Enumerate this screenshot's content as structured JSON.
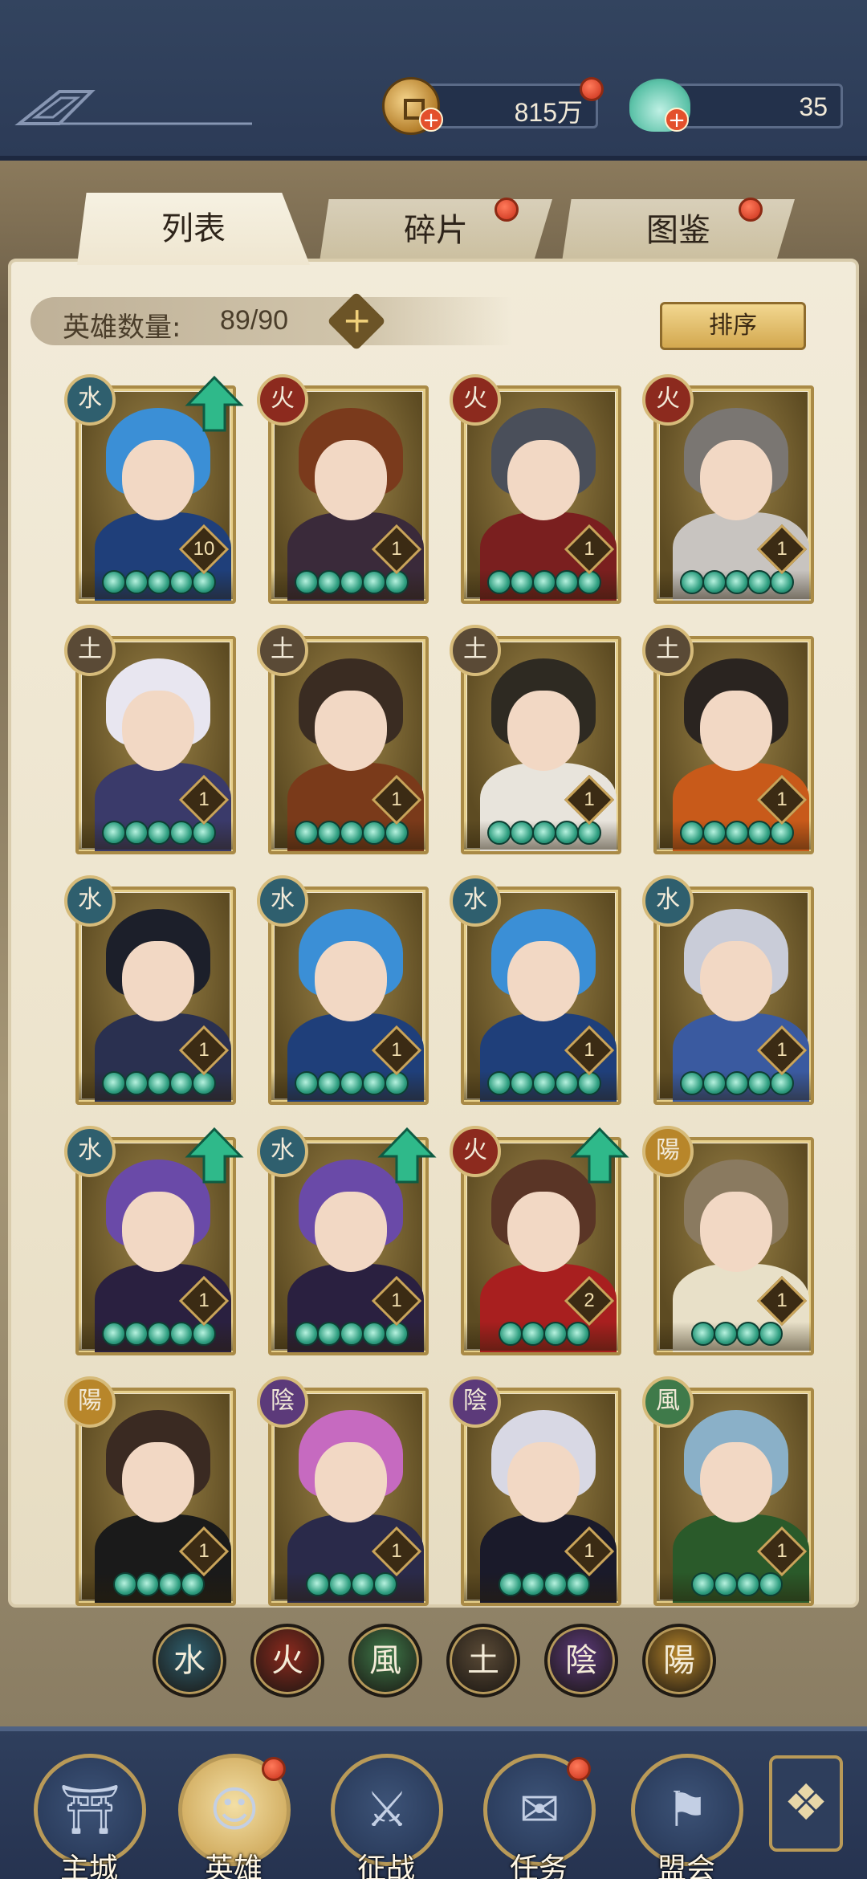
{
  "currency": {
    "coins": "815万",
    "jade": "35"
  },
  "tabs": [
    {
      "label": "列表",
      "active": true
    },
    {
      "label": "碎片",
      "active": false
    },
    {
      "label": "图鉴",
      "active": false
    }
  ],
  "hero_count": {
    "label": "英雄数量:",
    "value": "89/90"
  },
  "sort_button": "排序",
  "heroes": [
    {
      "element": "水",
      "level": "10",
      "stars": 5,
      "upgrade": true
    },
    {
      "element": "火",
      "level": "1",
      "stars": 5,
      "upgrade": false
    },
    {
      "element": "火",
      "level": "1",
      "stars": 5,
      "upgrade": false
    },
    {
      "element": "火",
      "level": "1",
      "stars": 5,
      "upgrade": false
    },
    {
      "element": "土",
      "level": "1",
      "stars": 5,
      "upgrade": false
    },
    {
      "element": "土",
      "level": "1",
      "stars": 5,
      "upgrade": false
    },
    {
      "element": "土",
      "level": "1",
      "stars": 5,
      "upgrade": false
    },
    {
      "element": "土",
      "level": "1",
      "stars": 5,
      "upgrade": false
    },
    {
      "element": "水",
      "level": "1",
      "stars": 5,
      "upgrade": false
    },
    {
      "element": "水",
      "level": "1",
      "stars": 5,
      "upgrade": false
    },
    {
      "element": "水",
      "level": "1",
      "stars": 5,
      "upgrade": false
    },
    {
      "element": "水",
      "level": "1",
      "stars": 5,
      "upgrade": false
    },
    {
      "element": "水",
      "level": "1",
      "stars": 5,
      "upgrade": true
    },
    {
      "element": "水",
      "level": "1",
      "stars": 5,
      "upgrade": true
    },
    {
      "element": "火",
      "level": "2",
      "stars": 4,
      "upgrade": true
    },
    {
      "element": "陽",
      "level": "1",
      "stars": 4,
      "upgrade": false
    },
    {
      "element": "陽",
      "level": "1",
      "stars": 4,
      "upgrade": false
    },
    {
      "element": "陰",
      "level": "1",
      "stars": 4,
      "upgrade": false
    },
    {
      "element": "陰",
      "level": "1",
      "stars": 4,
      "upgrade": false
    },
    {
      "element": "風",
      "level": "1",
      "stars": 4,
      "upgrade": false
    }
  ],
  "element_filters": [
    {
      "glyph": "水",
      "color": "#2f5f6e"
    },
    {
      "glyph": "火",
      "color": "#8c2a1e"
    },
    {
      "glyph": "風",
      "color": "#3f7a4a"
    },
    {
      "glyph": "土",
      "color": "#5a4a36"
    },
    {
      "glyph": "陰",
      "color": "#5c3a7a"
    },
    {
      "glyph": "陽",
      "color": "#b8862a"
    }
  ],
  "element_colors": {
    "水": "#2f5f6e",
    "火": "#8c2a1e",
    "土": "#5a4a36",
    "陽": "#b8862a",
    "陰": "#5c3a7a",
    "風": "#3f7a4a"
  },
  "nav": [
    {
      "label": "主城",
      "icon": "city-gate-icon",
      "active": false,
      "badge": false
    },
    {
      "label": "英雄",
      "icon": "hero-portrait-icon",
      "active": true,
      "badge": true
    },
    {
      "label": "征战",
      "icon": "battle-icon",
      "active": false,
      "badge": false
    },
    {
      "label": "任务",
      "icon": "scroll-icon",
      "active": false,
      "badge": true
    },
    {
      "label": "盟会",
      "icon": "alliance-icon",
      "active": false,
      "badge": false
    }
  ]
}
